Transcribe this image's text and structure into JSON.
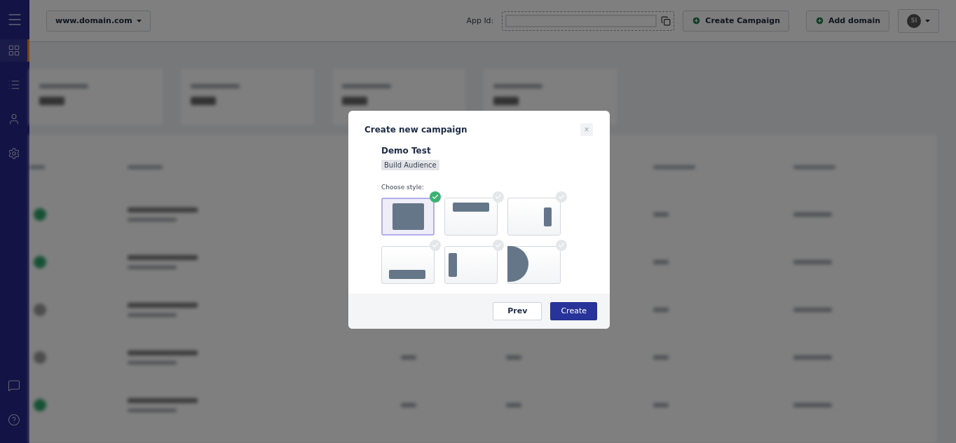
{
  "topbar": {
    "domain": "www.domain.com",
    "app_id_label": "App Id:",
    "buttons": [
      "Create Campaign",
      "Add domain"
    ],
    "avatar": "SI"
  },
  "sidebar": {
    "items": [
      {
        "selected": true
      },
      {
        "selected": false
      },
      {
        "selected": false
      },
      {
        "selected": false
      }
    ]
  },
  "background_rows": [
    {
      "on": true
    },
    {
      "on": true
    },
    {
      "on": false
    },
    {
      "on": false
    },
    {
      "on": true
    }
  ],
  "modal": {
    "title": "Create new campaign",
    "close": "×",
    "campaign_name": "Demo Test",
    "goal": "Build Audience",
    "choose_label": "Choose style:",
    "styles": [
      {
        "kind": "full",
        "selected": true
      },
      {
        "kind": "top",
        "selected": false
      },
      {
        "kind": "right",
        "selected": false
      },
      {
        "kind": "bottom",
        "selected": false
      },
      {
        "kind": "left",
        "selected": false
      },
      {
        "kind": "half-circle",
        "selected": false
      }
    ],
    "buttons": [
      {
        "label": "Prev",
        "kind": "secondary"
      },
      {
        "label": "Create",
        "kind": "primary"
      }
    ]
  }
}
